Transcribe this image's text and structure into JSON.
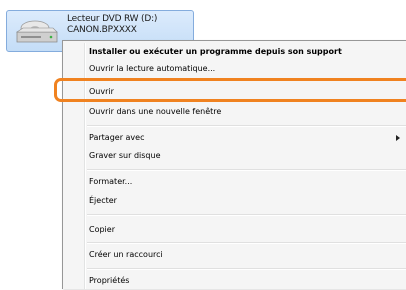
{
  "drive": {
    "name": "Lecteur DVD RW (D:)",
    "label": "CANON.BPXXXX",
    "icon": "dvd-drive-icon"
  },
  "menu": {
    "items": [
      {
        "label": "Installer ou exécuter un programme depuis son support",
        "bold": true
      },
      {
        "label": "Ouvrir la lecture automatique..."
      },
      {
        "label": "Ouvrir"
      },
      {
        "label": "Ouvrir dans une nouvelle fenêtre"
      },
      {
        "label": "Partager avec",
        "submenu": true
      },
      {
        "label": "Graver sur disque"
      },
      {
        "label": "Formater..."
      },
      {
        "label": "Éjecter"
      },
      {
        "label": "Copier"
      },
      {
        "label": "Créer un raccourci"
      },
      {
        "label": "Propriétés"
      }
    ],
    "highlighted_item": "Ouvrir",
    "highlight_color": "#f08220"
  }
}
